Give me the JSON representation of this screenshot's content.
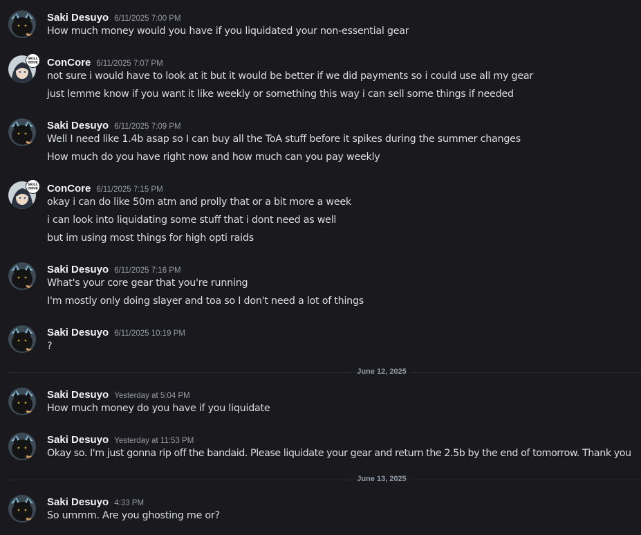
{
  "messages": [
    {
      "author": "Saki Desuyo",
      "timestamp": "6/11/2025 7:00 PM",
      "avatar_icon": "black-cat-avatar-icon",
      "lines": [
        "How much money would you have if you liquidated your non-essential gear"
      ]
    },
    {
      "author": "ConCore",
      "timestamp": "6/11/2025 7:07 PM",
      "avatar_icon": "anime-character-avatar-icon",
      "lines": [
        "not sure i would have to look at it but it would be better if we did payments so i could use all my gear",
        "just lemme know if you want it like weekly or something this way i can sell some things if needed"
      ]
    },
    {
      "author": "Saki Desuyo",
      "timestamp": "6/11/2025 7:09 PM",
      "avatar_icon": "black-cat-avatar-icon",
      "lines": [
        "Well I need like 1.4b asap so I can buy all the ToA stuff before it spikes during the summer changes",
        "How much do you have right now and how much can you pay weekly"
      ]
    },
    {
      "author": "ConCore",
      "timestamp": "6/11/2025 7:15 PM",
      "avatar_icon": "anime-character-avatar-icon",
      "lines": [
        "okay i can do like 50m atm and prolly that or a bit more a week",
        "i can look into liquidating some stuff that i dont need as well",
        "but im using most things for high opti raids"
      ]
    },
    {
      "author": "Saki Desuyo",
      "timestamp": "6/11/2025 7:16 PM",
      "avatar_icon": "black-cat-avatar-icon",
      "lines": [
        "What's your core gear that you're running",
        "I'm mostly only doing slayer and toa so I don't need a lot of things"
      ]
    },
    {
      "author": "Saki Desuyo",
      "timestamp": "6/11/2025 10:19 PM",
      "avatar_icon": "black-cat-avatar-icon",
      "lines": [
        "?"
      ]
    },
    {
      "author": "Saki Desuyo",
      "timestamp": "Yesterday at 5:04 PM",
      "avatar_icon": "black-cat-avatar-icon",
      "lines": [
        "How much money do you have if you liquidate"
      ]
    },
    {
      "author": "Saki Desuyo",
      "timestamp": "Yesterday at 11:53 PM",
      "avatar_icon": "black-cat-avatar-icon",
      "lines": [
        "Okay so. I'm just gonna rip off the bandaid. Please liquidate your gear and return the 2.5b by the end of tomorrow. Thank you"
      ]
    },
    {
      "author": "Saki Desuyo",
      "timestamp": "4:33 PM",
      "avatar_icon": "black-cat-avatar-icon",
      "lines": [
        "So ummm. Are you ghosting me or?"
      ]
    }
  ],
  "dividers": [
    "June 12, 2025",
    "June 13, 2025"
  ],
  "avatar_badge_text": "SKILL ISSUE",
  "colors": {
    "background": "#1a1a1e",
    "author": "#f2f3f5",
    "timestamp": "#949ba4",
    "message_text": "#dbdee1",
    "divider": "#2e2f35"
  }
}
